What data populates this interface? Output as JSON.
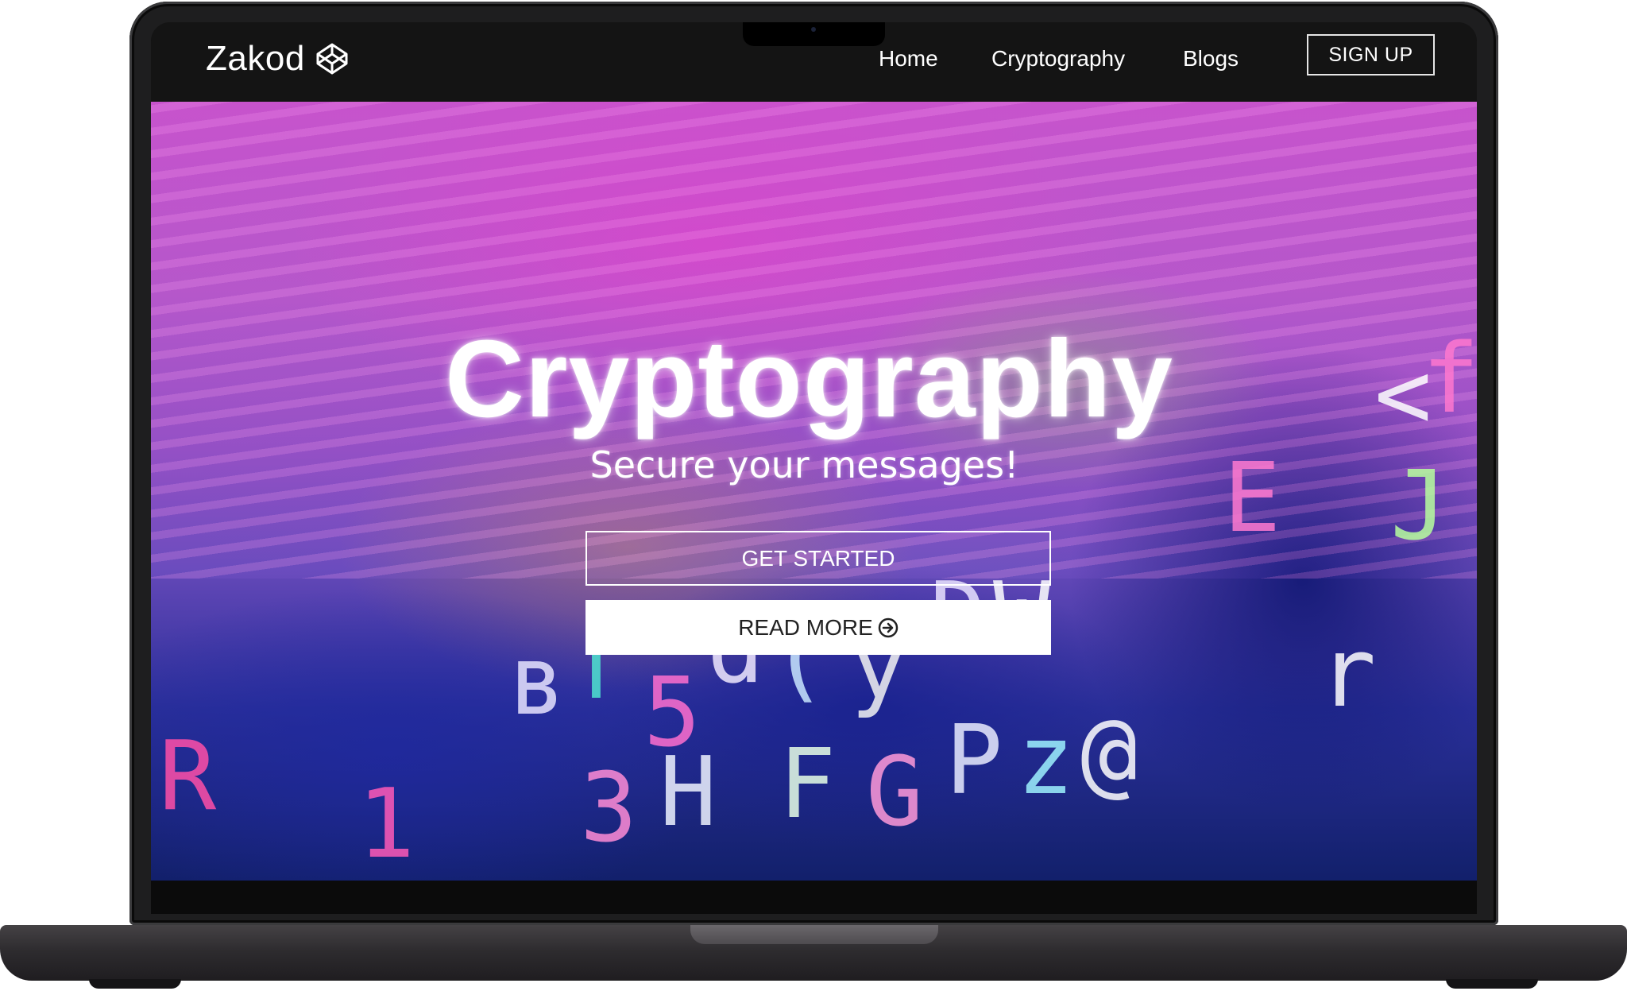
{
  "brand": {
    "name": "Zakod",
    "logo_icon": "codepen-cube-icon"
  },
  "nav": {
    "items": [
      {
        "label": "Home"
      },
      {
        "label": "Cryptography"
      },
      {
        "label": "Blogs"
      }
    ],
    "signup_label": "SIGN UP"
  },
  "hero": {
    "title": "Cryptography",
    "subtitle": "Secure your messages!",
    "primary_button": "GET STARTED",
    "secondary_button": "READ MORE",
    "secondary_icon": "arrow-right-circle-icon"
  },
  "colors": {
    "navbar_bg": "#141414",
    "hero_pink": "#c44fc8",
    "hero_blue": "#12206b",
    "device_frame": "#1e1e1f"
  }
}
